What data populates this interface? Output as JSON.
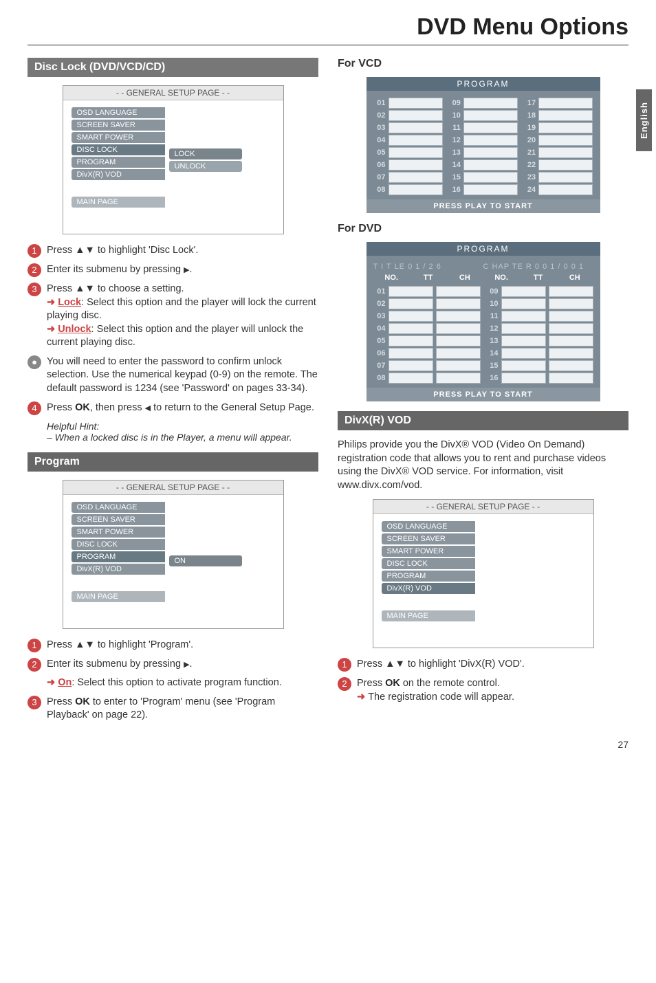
{
  "page_title": "DVD Menu Options",
  "side_tab": "English",
  "page_number": "27",
  "tri_updown": "▲▼",
  "tri_right": "▶",
  "tri_left": "◀",
  "left": {
    "sec1_head": "Disc Lock (DVD/VCD/CD)",
    "setup1": {
      "header": "- - GENERAL SETUP PAGE - -",
      "items": [
        "OSD LANGUAGE",
        "SCREEN SAVER",
        "SMART POWER",
        "DISC LOCK",
        "PROGRAM",
        "DivX(R) VOD"
      ],
      "sub": [
        "LOCK",
        "UNLOCK"
      ],
      "main_page": "MAIN PAGE"
    },
    "steps1": {
      "s1": "Press ▲▼ to highlight 'Disc Lock'.",
      "s2_a": "Enter its submenu by pressing ",
      "s2_b": ".",
      "s3a": "Press ▲▼ to choose a setting.",
      "s3_lock_key": "Lock",
      "s3_lock_text": ": Select this option and the player will lock the current playing disc.",
      "s3_unlock_key": "Unlock",
      "s3_unlock_text": ": Select this option and the player will unlock the current playing disc.",
      "bullet": "You will need to enter the password to confirm unlock selection.  Use the numerical keypad (0-9) on the remote. The default password is 1234 (see 'Password' on pages 33-34).",
      "s4a": "Press ",
      "s4b": "OK",
      "s4c": ", then press ",
      "s4d": " to return to the General Setup Page."
    },
    "hint_title": "Helpful Hint:",
    "hint_body": "–   When a locked disc is in the Player, a menu will appear.",
    "sec2_head": "Program",
    "setup2": {
      "header": "- - GENERAL SETUP PAGE - -",
      "items": [
        "OSD LANGUAGE",
        "SCREEN SAVER",
        "SMART POWER",
        "DISC LOCK",
        "PROGRAM",
        "DivX(R) VOD"
      ],
      "sub": [
        "ON"
      ],
      "main_page": "MAIN PAGE"
    },
    "steps2": {
      "s1": "Press ▲▼ to highlight 'Program'.",
      "s2_a": "Enter its submenu by pressing ",
      "s2_b": ".",
      "on_key": "On",
      "on_text": ": Select this option to activate program function.",
      "s3a": "Press ",
      "s3b": "OK",
      "s3c": " to enter to 'Program' menu (see 'Program Playback' on page 22)."
    }
  },
  "right": {
    "vcd_head": "For VCD",
    "dvd_head": "For DVD",
    "program_label": "PROGRAM",
    "program_footer": "PRESS PLAY TO START",
    "vcd": {
      "cols": [
        [
          "01",
          "02",
          "03",
          "04",
          "05",
          "06",
          "07",
          "08"
        ],
        [
          "09",
          "10",
          "11",
          "12",
          "13",
          "14",
          "15",
          "16"
        ],
        [
          "17",
          "18",
          "19",
          "20",
          "21",
          "22",
          "23",
          "24"
        ]
      ]
    },
    "dvd": {
      "title_line_a": "T I T LE 0 1 / 2 6",
      "title_line_b": "C HAP TE R 0 0 1 / 0 0 1",
      "th": [
        "NO.",
        "TT",
        "CH",
        "NO.",
        "TT",
        "CH"
      ],
      "rows_left": [
        "01",
        "02",
        "03",
        "04",
        "05",
        "06",
        "07",
        "08"
      ],
      "rows_right": [
        "09",
        "10",
        "11",
        "12",
        "13",
        "14",
        "15",
        "16"
      ]
    },
    "divx_head": "DivX(R) VOD",
    "divx_text": "Philips provide you the DivX® VOD (Video On Demand) registration code that allows you to rent and purchase videos using the DivX® VOD service. For information, visit www.divx.com/vod.",
    "setup3": {
      "header": "- - GENERAL SETUP PAGE - -",
      "items": [
        "OSD LANGUAGE",
        "SCREEN SAVER",
        "SMART POWER",
        "DISC LOCK",
        "PROGRAM",
        "DivX(R) VOD"
      ],
      "main_page": "MAIN PAGE"
    },
    "steps": {
      "s1": "Press ▲▼ to highlight 'DivX(R) VOD'.",
      "s2a": "Press ",
      "s2b": "OK",
      "s2c": " on the remote control.",
      "s2d": "The registration code will appear."
    }
  }
}
